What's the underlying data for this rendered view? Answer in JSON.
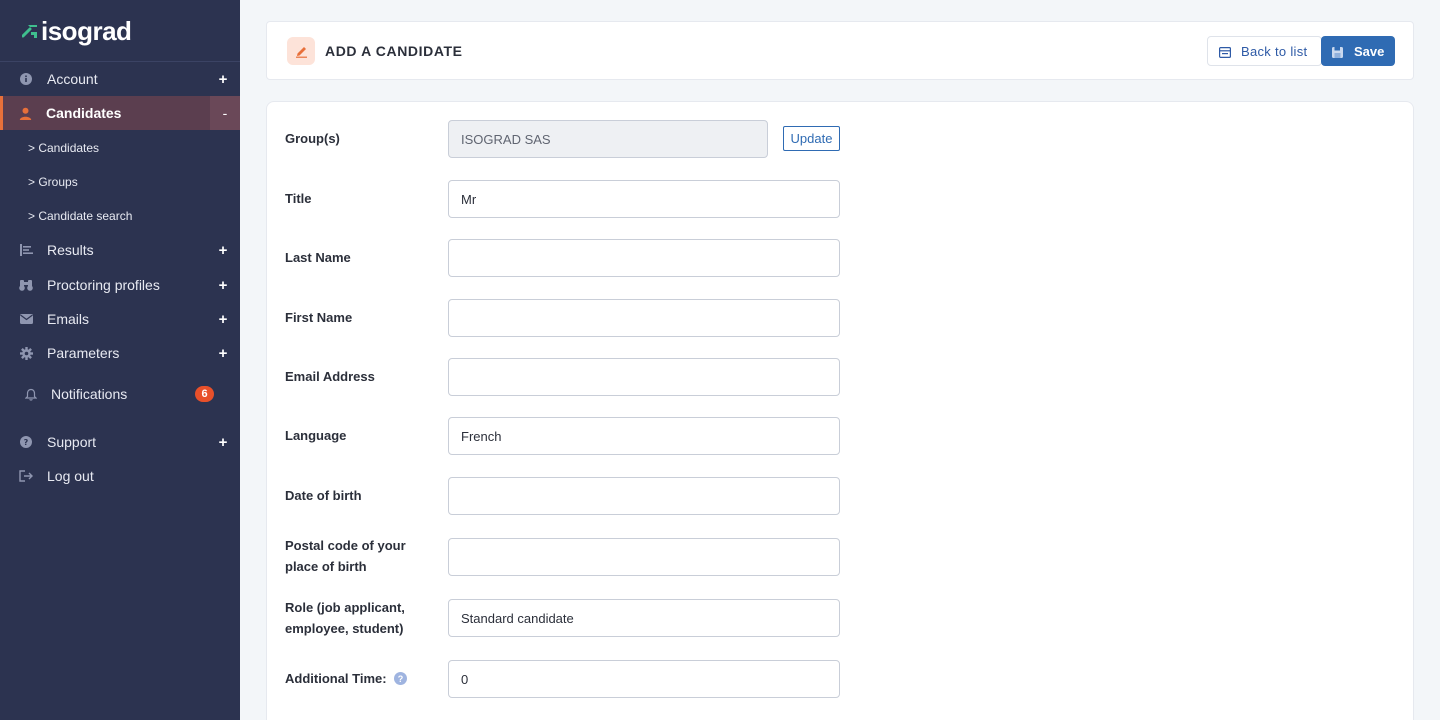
{
  "sidebar": {
    "logo_text": "isograd",
    "nav": {
      "account": "Account",
      "candidates": "Candidates",
      "results": "Results",
      "proctoring": "Proctoring profiles",
      "emails": "Emails",
      "parameters": "Parameters",
      "notifications": "Notifications",
      "support": "Support",
      "logout": "Log out"
    },
    "sub": {
      "candidates": "> Candidates",
      "groups": "> Groups",
      "search": "> Candidate search"
    },
    "toggles": {
      "expand": "+",
      "collapse": "-"
    },
    "notifications_count": "6"
  },
  "header": {
    "title": "ADD A CANDIDATE",
    "back_label": "Back to list",
    "save_label": "Save"
  },
  "form": {
    "groups": {
      "label": "Group(s)",
      "value": "ISOGRAD SAS",
      "update_label": "Update"
    },
    "title": {
      "label": "Title",
      "value": "Mr"
    },
    "last_name": {
      "label": "Last Name",
      "value": ""
    },
    "first_name": {
      "label": "First Name",
      "value": ""
    },
    "email": {
      "label": "Email Address",
      "value": ""
    },
    "language": {
      "label": "Language",
      "value": "French"
    },
    "dob": {
      "label": "Date of birth",
      "value": ""
    },
    "postal": {
      "label_line1": "Postal code of your",
      "label_line2": "place of birth",
      "value": ""
    },
    "role": {
      "label_line1": "Role (job applicant,",
      "label_line2": "employee, student)",
      "value": "Standard candidate"
    },
    "additional_time": {
      "label": "Additional Time:",
      "value": "0",
      "help": "?"
    }
  },
  "colors": {
    "sidebar_bg": "#2c3350",
    "active_bg": "#5b3e4f",
    "accent": "#e8703a",
    "primary": "#2f6bb3",
    "badge": "#e8502a"
  }
}
